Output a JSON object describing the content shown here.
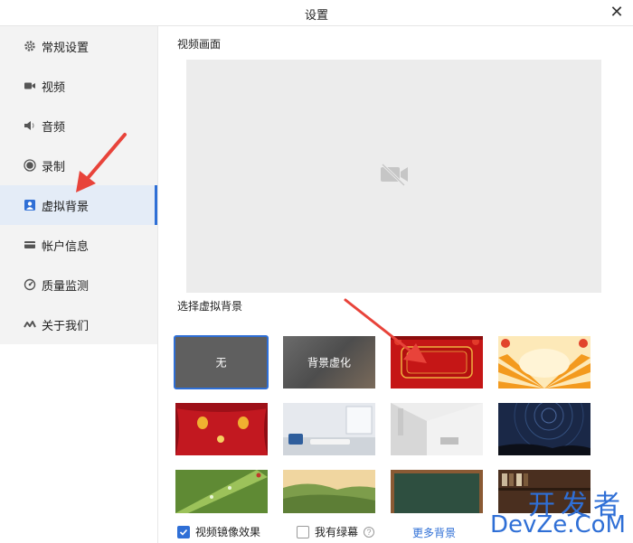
{
  "window": {
    "title": "设置",
    "close_symbol": "✕"
  },
  "sidebar": {
    "items": [
      {
        "label": "常规设置",
        "icon": "gear-icon"
      },
      {
        "label": "视频",
        "icon": "camera-icon"
      },
      {
        "label": "音频",
        "icon": "speaker-icon"
      },
      {
        "label": "录制",
        "icon": "record-icon"
      },
      {
        "label": "虚拟背景",
        "icon": "portrait-icon",
        "active": true
      },
      {
        "label": "帐户信息",
        "icon": "card-icon"
      },
      {
        "label": "质量监测",
        "icon": "gauge-icon"
      },
      {
        "label": "关于我们",
        "icon": "logo-icon"
      }
    ]
  },
  "main": {
    "preview_label": "视频画面",
    "preview_icon": "camera-off-icon",
    "background_label": "选择虚拟背景",
    "backgrounds": [
      {
        "label": "无",
        "selected": true
      },
      {
        "label": "背景虚化"
      },
      {
        "label": ""
      },
      {
        "label": ""
      },
      {
        "label": ""
      },
      {
        "label": ""
      },
      {
        "label": ""
      },
      {
        "label": ""
      },
      {
        "label": ""
      },
      {
        "label": ""
      },
      {
        "label": ""
      },
      {
        "label": ""
      }
    ]
  },
  "footer": {
    "mirror_label": "视频镜像效果",
    "mirror_checked": true,
    "greenscreen_label": "我有绿幕",
    "greenscreen_checked": false,
    "help_symbol": "?",
    "more_link": "更多背景"
  },
  "watermark": {
    "line1": "开发者",
    "line2": "DevZe.CoM"
  },
  "colors": {
    "accent": "#2f6fd6",
    "annotation_arrow": "#e8433a"
  }
}
